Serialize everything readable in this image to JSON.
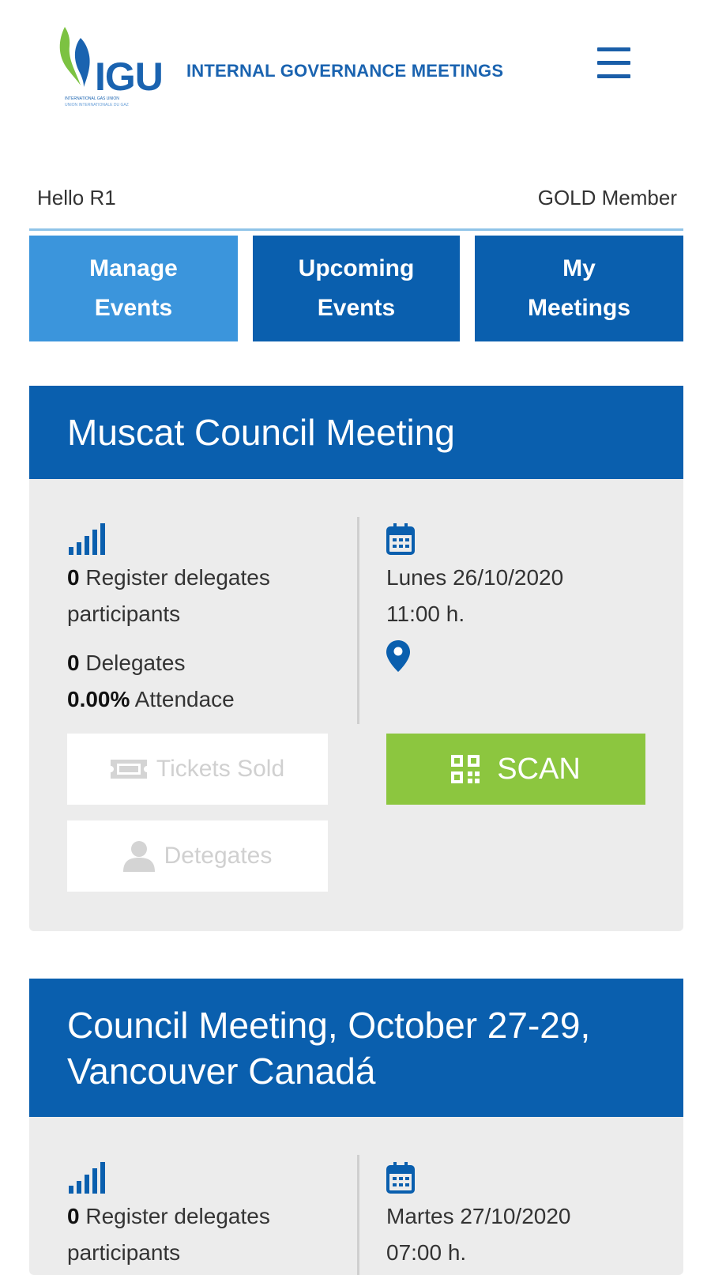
{
  "header": {
    "logo_text": "IGU",
    "logo_sub_1": "INTERNATIONAL GAS UNION",
    "logo_sub_2": "UNION INTERNATIONALE DU GAZ",
    "title": "INTERNAL GOVERNANCE MEETINGS"
  },
  "user": {
    "greeting": "Hello R1",
    "membership": "GOLD Member"
  },
  "tabs": {
    "manage": [
      "Manage",
      "Events"
    ],
    "upcoming": [
      "Upcoming",
      "Events"
    ],
    "meetings": [
      "My",
      "Meetings"
    ]
  },
  "events": [
    {
      "title": "Muscat Council Meeting",
      "register_count": "0",
      "register_label_1": "Register delegates",
      "register_label_2": "participants",
      "delegates_count": "0",
      "delegates_label": "Delegates",
      "attendance_value": "0.00%",
      "attendance_label": "Attendace",
      "date": "Lunes 26/10/2020",
      "time": "11:00 h.",
      "tickets_label": "Tickets Sold",
      "delegates_button_label": "Detegates",
      "scan_label": "SCAN"
    },
    {
      "title_line_1": "Council Meeting, October 27-29,",
      "title_line_2": "Vancouver Canadá",
      "register_count": "0",
      "register_label_1": "Register delegates",
      "register_label_2": "participants",
      "date": "Martes 27/10/2020",
      "time": "07:00 h."
    }
  ],
  "colors": {
    "primary": "#0a5fae",
    "tab_active": "#3b95dc",
    "scan": "#8cc63f",
    "card_bg": "#ececec"
  }
}
